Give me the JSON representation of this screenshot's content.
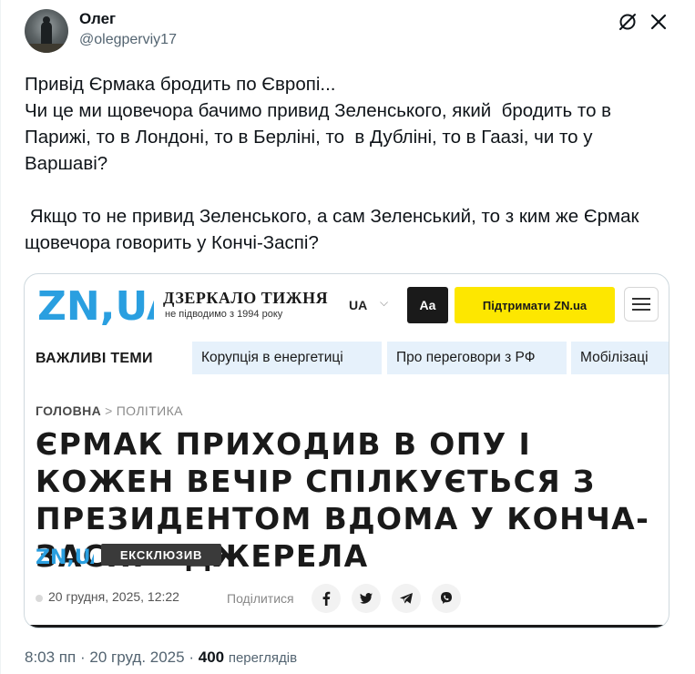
{
  "author": {
    "display_name": "Олег",
    "handle": "@olegperviy17"
  },
  "icons": {
    "grok": "grok-icon",
    "more": "more-icon"
  },
  "tweet_text": "Привід Єрмака бродить по Європі...\nЧи це ми щовечора бачимо привид Зеленського, який  бродить то в Парижі, то в Лондоні, то в Берліні, то  в Дубліні, то в Гаазі, чи то у Варшаві?\n\n Якщо то не привид Зеленського, а сам Зеленський, то з ким же Єрмак щовечора говорить у Кончі-Заспі?",
  "article_card": {
    "logo_text": "ZN,UA",
    "site_title": "ДЗЕРКАЛО ТИЖНЯ",
    "site_subtitle": "не підводимо з 1994 року",
    "language": "UA",
    "aa_button": "Aa",
    "support_button": "Підтримати ZN.ua",
    "topics_label": "ВАЖЛИВІ ТЕМИ",
    "topics": [
      "Корупція в енергетиці",
      "Про переговори з РФ",
      "Мобілізаці"
    ],
    "breadcrumb_home": "ГОЛОВНА",
    "breadcrumb_separator": ">",
    "breadcrumb_section": "ПОЛІТИКА",
    "headline": "ЄРМАК ПРИХОДИВ В ОПУ І КОЖЕН ВЕЧІР СПІЛКУЄТЬСЯ З ПРЕЗИДЕНТОМ ВДОМА У КОНЧА-ЗАСПІ – ДЖЕРЕЛА",
    "badge": "ЕКСКЛЮЗИВ",
    "date": "20 грудня, 2025, 12:22",
    "share_label": "Поділитися",
    "share_icons": [
      "facebook-icon",
      "twitter-icon",
      "telegram-icon",
      "viber-icon"
    ],
    "colors": {
      "brand_blue": "#2a9fe0",
      "support_yellow": "#fde700",
      "topic_bg": "#e6f1fb"
    }
  },
  "meta": {
    "time": "8:03 пп",
    "separator": "·",
    "date": "20 груд. 2025",
    "views_count": "400",
    "views_label": "переглядів"
  }
}
